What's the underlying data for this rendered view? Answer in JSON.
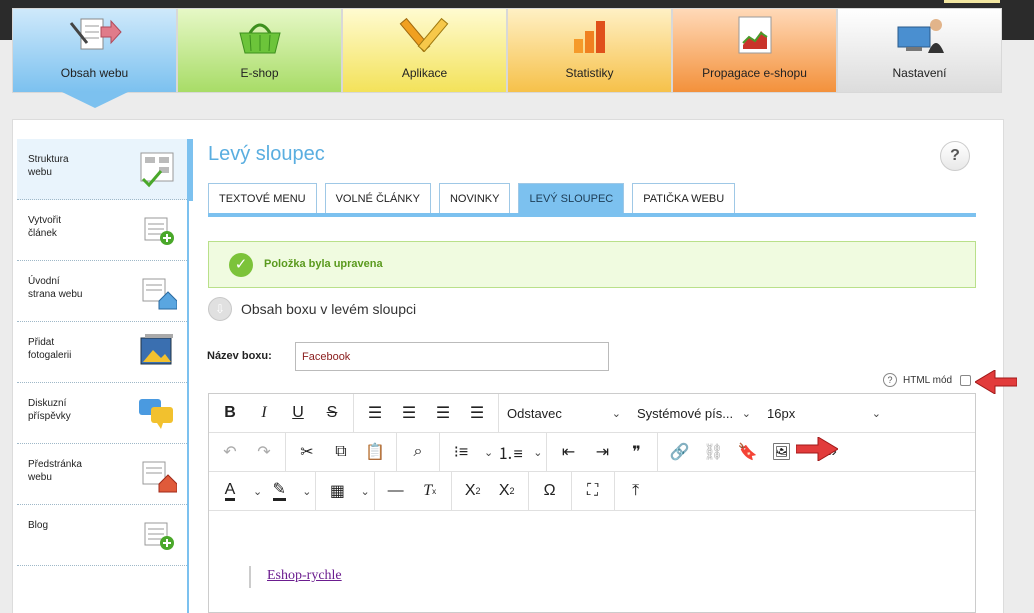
{
  "topnav": [
    {
      "label": "Obsah webu",
      "icon": "content-icon"
    },
    {
      "label": "E-shop",
      "icon": "basket-icon"
    },
    {
      "label": "Aplikace",
      "icon": "tools-icon"
    },
    {
      "label": "Statistiky",
      "icon": "bars-chart-icon"
    },
    {
      "label": "Propagace e-shopu",
      "icon": "promo-chart-icon"
    },
    {
      "label": "Nastavení",
      "icon": "user-computer-icon"
    }
  ],
  "sidebar": [
    {
      "label": "Struktura webu",
      "line1": "Struktura",
      "line2": "webu",
      "icon": "structure-icon"
    },
    {
      "label": "Vytvořit článek",
      "line1": "Vytvořit",
      "line2": "článek",
      "icon": "add-article-icon"
    },
    {
      "label": "Úvodní strana webu",
      "line1": "Úvodní",
      "line2": "strana webu",
      "icon": "home-page-icon"
    },
    {
      "label": "Přidat fotogalerii",
      "line1": "Přidat",
      "line2": "fotogalerii",
      "icon": "gallery-icon"
    },
    {
      "label": "Diskuzní příspěvky",
      "line1": "Diskuzní",
      "line2": "příspěvky",
      "icon": "discussion-icon"
    },
    {
      "label": "Předstránka webu",
      "line1": "Předstránka",
      "line2": "webu",
      "icon": "landing-page-icon"
    },
    {
      "label": "Blog",
      "line1": "Blog",
      "line2": "",
      "icon": "blog-icon"
    }
  ],
  "page": {
    "title": "Levý sloupec",
    "help": "?"
  },
  "tabs": [
    {
      "label": "TEXTOVÉ MENU",
      "active": false
    },
    {
      "label": "VOLNÉ ČLÁNKY",
      "active": false
    },
    {
      "label": "NOVINKY",
      "active": false
    },
    {
      "label": "LEVÝ SLOUPEC",
      "active": true
    },
    {
      "label": "PATIČKA WEBU",
      "active": false
    }
  ],
  "alert": {
    "message": "Položka byla upravena"
  },
  "section": {
    "title": "Obsah boxu v levém sloupci"
  },
  "form": {
    "name_label": "Název boxu:",
    "name_value": "Facebook",
    "html_mode_label": "HTML mód",
    "html_mode_checked": false
  },
  "editor": {
    "format_select": "Odstavec",
    "font_select": "Systémové pís...",
    "size_select": "16px",
    "content_link": "Eshop-rychle"
  },
  "colors": {
    "accent_blue": "#7cc1ef",
    "title_blue": "#5aaee0",
    "success_green": "#7cc33a",
    "arrow_red": "#e23b3b"
  }
}
